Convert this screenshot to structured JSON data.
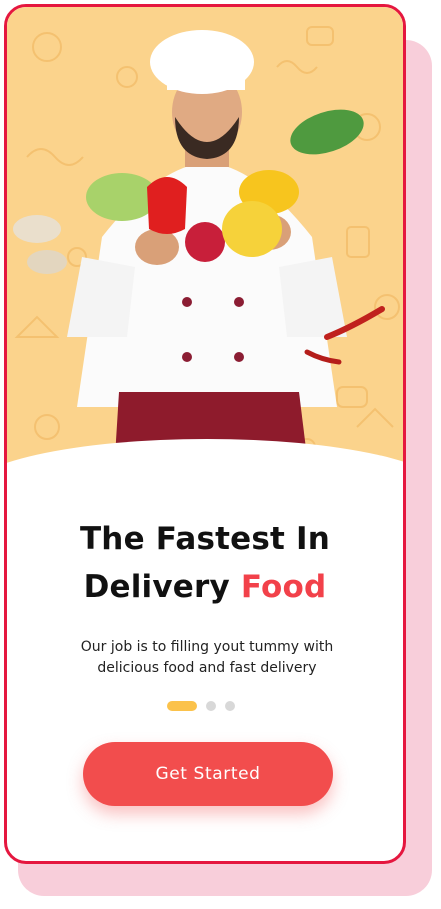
{
  "onboarding": {
    "title_line1": "The Fastest In",
    "title_line2_prefix": "Delivery ",
    "title_line2_accent": "Food",
    "subtitle_line1": "Our job is to filling yout tummy with",
    "subtitle_line2": "delicious food and fast delivery",
    "pager": {
      "total": 3,
      "active": 1
    },
    "cta_label": "Get Started"
  },
  "colors": {
    "frame": "#e5173f",
    "hero_background": "#fbd38c",
    "accent": "#f2414a",
    "button": "#f24d4d",
    "active_dot": "#fbc24b"
  },
  "hero": {
    "image": "chef-holding-vegetables"
  }
}
